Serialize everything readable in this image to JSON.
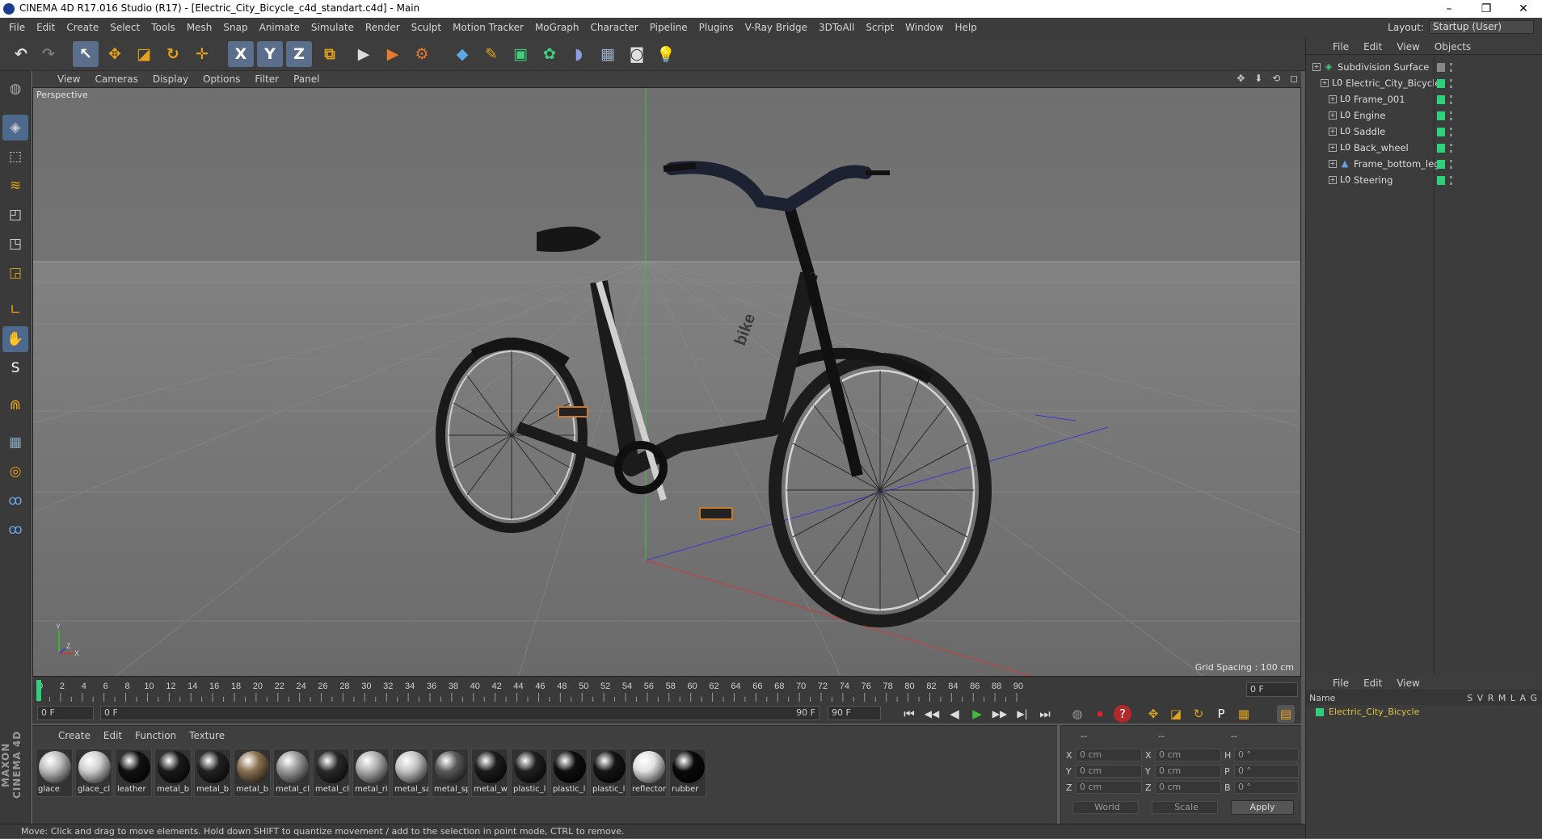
{
  "window": {
    "title": "CINEMA 4D R17.016 Studio (R17) - [Electric_City_Bicycle_c4d_standart.c4d] - Main",
    "minimize": "–",
    "maximize": "❐",
    "close": "✕"
  },
  "menu": [
    "File",
    "Edit",
    "Create",
    "Select",
    "Tools",
    "Mesh",
    "Snap",
    "Animate",
    "Simulate",
    "Render",
    "Sculpt",
    "Motion Tracker",
    "MoGraph",
    "Character",
    "Pipeline",
    "Plugins",
    "V-Ray Bridge",
    "3DToAll",
    "Script",
    "Window",
    "Help"
  ],
  "layout": {
    "label": "Layout:",
    "value": "Startup (User)"
  },
  "toolbar": {
    "undo": "↶",
    "redo": "↷",
    "select": "↖",
    "move": "✥",
    "scale": "◪",
    "rotate": "↻",
    "transform": "✛",
    "x": "X",
    "y": "Y",
    "z": "Z",
    "coord": "⧉",
    "render_view": "▶",
    "render_pv": "▶",
    "render_settings": "⚙",
    "cube": "◆",
    "pen": "✎",
    "subdiv": "▣",
    "mograph": "✿",
    "deformer": "◗",
    "floor": "▦",
    "camera": "◙",
    "light": "💡"
  },
  "lefttools": [
    "◍",
    "◈",
    "⬚",
    "≋",
    "◰",
    "◳",
    "◲",
    "∟",
    "✋",
    "S",
    "⋒",
    "▦",
    "◎",
    "ꝏ",
    "ꝏ"
  ],
  "brand": "MAXON CINEMA 4D",
  "viewport": {
    "menu": [
      "View",
      "Cameras",
      "Display",
      "Options",
      "Filter",
      "Panel"
    ],
    "nav": "✥ ⬇ ⟲ ◻",
    "label": "Perspective",
    "grid_spacing": "Grid Spacing : 100 cm",
    "axis": {
      "y": "Y",
      "x": "X",
      "z": "Z"
    },
    "bike_text": "bike"
  },
  "timeline": {
    "ticks": [
      "0",
      "2",
      "4",
      "6",
      "8",
      "10",
      "12",
      "14",
      "16",
      "18",
      "20",
      "22",
      "24",
      "26",
      "28",
      "30",
      "32",
      "34",
      "36",
      "38",
      "40",
      "42",
      "44",
      "46",
      "48",
      "50",
      "52",
      "54",
      "56",
      "58",
      "60",
      "62",
      "64",
      "66",
      "68",
      "70",
      "72",
      "74",
      "76",
      "78",
      "80",
      "82",
      "84",
      "86",
      "88",
      "90"
    ],
    "current": "0 F",
    "start": "0 F",
    "range_start": "0 F",
    "range_end": "90 F",
    "end": "90 F"
  },
  "playback": [
    "⏮",
    "◀◀",
    "◀",
    "▶",
    "▶▶",
    "▶|",
    "⏭"
  ],
  "keys": [
    "◍",
    "⏺",
    "?",
    "✥",
    "◪",
    "↻",
    "P",
    "▦",
    "▤"
  ],
  "materials": {
    "menu": [
      "Create",
      "Edit",
      "Function",
      "Texture"
    ],
    "items": [
      {
        "label": "glace",
        "color": "#bdbdbd"
      },
      {
        "label": "glace_cl",
        "color": "#d0d0d0"
      },
      {
        "label": "leather",
        "color": "#111111"
      },
      {
        "label": "metal_b",
        "color": "#1a1a1a"
      },
      {
        "label": "metal_b",
        "color": "#222222"
      },
      {
        "label": "metal_b",
        "color": "#8a7050"
      },
      {
        "label": "metal_cl",
        "color": "#9a9a9a"
      },
      {
        "label": "metal_cl",
        "color": "#2a2a2a"
      },
      {
        "label": "metal_ri",
        "color": "#b0b0b0"
      },
      {
        "label": "metal_sa",
        "color": "#c4c4c4"
      },
      {
        "label": "metal_sp",
        "color": "#5a5a5a"
      },
      {
        "label": "metal_w",
        "color": "#1c1c1c"
      },
      {
        "label": "plastic_l",
        "color": "#202020"
      },
      {
        "label": "plastic_l",
        "color": "#0e0e0e"
      },
      {
        "label": "plastic_l",
        "color": "#151515"
      },
      {
        "label": "reflector",
        "color": "#e0e0e0"
      },
      {
        "label": "rubber",
        "color": "#0a0a0a"
      }
    ]
  },
  "attributes": {
    "headers": [
      "--",
      "--",
      "--"
    ],
    "rows": [
      {
        "a": "X",
        "av": "0 cm",
        "b": "X",
        "bv": "0 cm",
        "c": "H",
        "cv": "0 °"
      },
      {
        "a": "Y",
        "av": "0 cm",
        "b": "Y",
        "bv": "0 cm",
        "c": "P",
        "cv": "0 °"
      },
      {
        "a": "Z",
        "av": "0 cm",
        "b": "Z",
        "bv": "0 cm",
        "c": "B",
        "cv": "0 °"
      }
    ],
    "world": "World",
    "scale": "Scale",
    "apply": "Apply"
  },
  "objects": {
    "menu": [
      "File",
      "Edit",
      "View",
      "Objects"
    ],
    "tree": [
      {
        "name": "Subdivision Surface",
        "indent": 0,
        "icon": "◈"
      },
      {
        "name": "Electric_City_Bicycle",
        "indent": 1,
        "icon": "L0"
      },
      {
        "name": "Frame_001",
        "indent": 2,
        "icon": "L0"
      },
      {
        "name": "Engine",
        "indent": 2,
        "icon": "L0"
      },
      {
        "name": "Saddle",
        "indent": 2,
        "icon": "L0"
      },
      {
        "name": "Back_wheel",
        "indent": 2,
        "icon": "L0"
      },
      {
        "name": "Frame_bottom_leg",
        "indent": 2,
        "icon": "▲"
      },
      {
        "name": "Steering",
        "indent": 2,
        "icon": "L0"
      }
    ]
  },
  "layers": {
    "menu": [
      "File",
      "Edit",
      "View"
    ],
    "header": "Name",
    "cols": "S V R M L A G",
    "row": "Electric_City_Bicycle"
  },
  "status": "Move: Click and drag to move elements. Hold down SHIFT to quantize movement / add to the selection in point mode, CTRL to remove.",
  "colors": {
    "accent": "#2fd07a",
    "layer": "#e0c43a",
    "active_tool": "#5b6f8c"
  }
}
